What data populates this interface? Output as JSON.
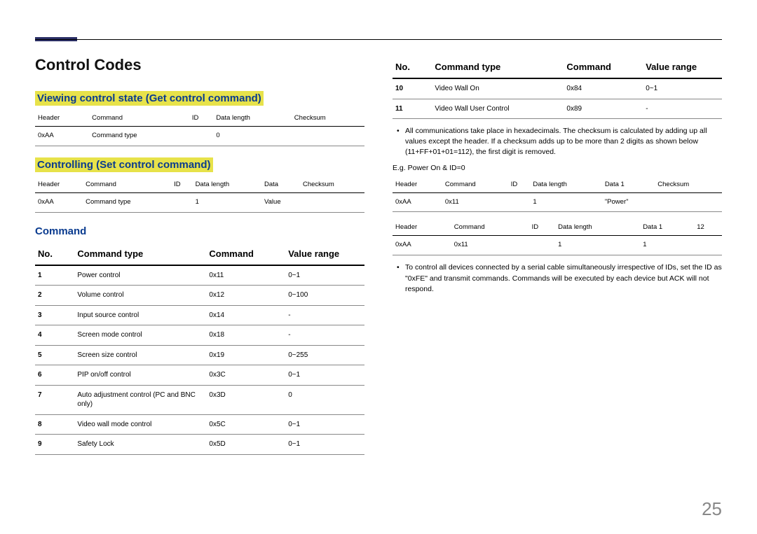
{
  "pageTitle": "Control Codes",
  "pageNumber": "25",
  "left": {
    "sec1": {
      "title": "Viewing control state (Get control command)",
      "headers": [
        "Header",
        "Command",
        "ID",
        "Data length",
        "Checksum"
      ],
      "row": [
        "0xAA",
        "Command type",
        "",
        "0",
        ""
      ]
    },
    "sec2": {
      "title": "Controlling (Set control command)",
      "headers": [
        "Header",
        "Command",
        "ID",
        "Data length",
        "Data",
        "Checksum"
      ],
      "row": [
        "0xAA",
        "Command type",
        "",
        "1",
        "Value",
        ""
      ]
    },
    "sec3": {
      "title": "Command",
      "headers": [
        "No.",
        "Command type",
        "Command",
        "Value range"
      ],
      "rows": [
        [
          "1",
          "Power control",
          "0x11",
          "0~1"
        ],
        [
          "2",
          "Volume control",
          "0x12",
          "0~100"
        ],
        [
          "3",
          "Input source control",
          "0x14",
          "-"
        ],
        [
          "4",
          "Screen mode control",
          "0x18",
          "-"
        ],
        [
          "5",
          "Screen size control",
          "0x19",
          "0~255"
        ],
        [
          "6",
          "PIP on/off control",
          "0x3C",
          "0~1"
        ],
        [
          "7",
          "Auto adjustment control (PC and BNC only)",
          "0x3D",
          "0"
        ],
        [
          "8",
          "Video wall mode control",
          "0x5C",
          "0~1"
        ],
        [
          "9",
          "Safety Lock",
          "0x5D",
          "0~1"
        ]
      ]
    }
  },
  "right": {
    "cont": {
      "headers": [
        "No.",
        "Command type",
        "Command",
        "Value range"
      ],
      "rows": [
        [
          "10",
          "Video Wall On",
          "0x84",
          "0~1"
        ],
        [
          "11",
          "Video Wall User Control",
          "0x89",
          "-"
        ]
      ]
    },
    "note1": "All communications take place in hexadecimals. The checksum is calculated by adding up all values except the header. If a checksum adds up to be more than 2 digits as shown below (11+FF+01+01=112), the first digit is removed.",
    "eg": "E.g. Power On & ID=0",
    "t1": {
      "headers": [
        "Header",
        "Command",
        "ID",
        "Data length",
        "Data 1",
        "Checksum"
      ],
      "row": [
        "0xAA",
        "0x11",
        "",
        "1",
        "\"Power\"",
        ""
      ]
    },
    "t2": {
      "headers": [
        "Header",
        "Command",
        "ID",
        "Data length",
        "Data 1",
        "12"
      ],
      "row": [
        "0xAA",
        "0x11",
        "",
        "1",
        "1",
        ""
      ]
    },
    "note2": "To control all devices connected by a serial cable simultaneously irrespective of IDs, set the ID as \"0xFE\" and transmit commands. Commands will be executed by each device but ACK will not respond."
  }
}
